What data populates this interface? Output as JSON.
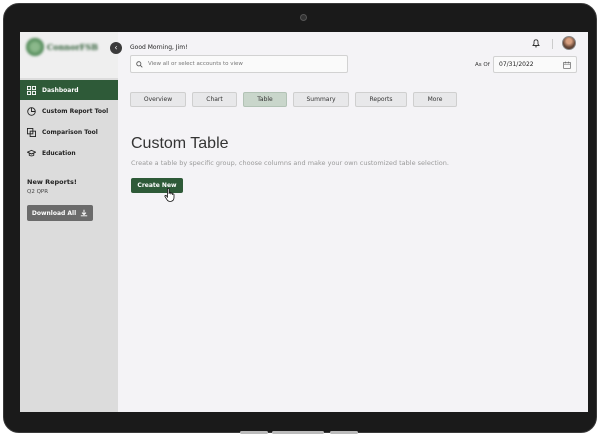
{
  "brand": {
    "logo_text": "ConnorFSB"
  },
  "sidebar": {
    "items": [
      {
        "label": "Dashboard",
        "icon": "dashboard-icon",
        "active": true
      },
      {
        "label": "Custom Report Tool",
        "icon": "pie-chart-icon",
        "active": false
      },
      {
        "label": "Comparison Tool",
        "icon": "compare-icon",
        "active": false
      },
      {
        "label": "Education",
        "icon": "graduation-cap-icon",
        "active": false
      }
    ],
    "new_reports_title": "New Reports!",
    "new_reports_sub": "Q2 QPR",
    "download_label": "Download All"
  },
  "header": {
    "greeting": "Good Morning, Jim!",
    "search_placeholder": "View all or select accounts to view",
    "as_of_label": "As Of",
    "date_value": "07/31/2022"
  },
  "tabs": [
    {
      "label": "Overview",
      "active": false
    },
    {
      "label": "Chart",
      "active": false
    },
    {
      "label": "Table",
      "active": true
    },
    {
      "label": "Summary",
      "active": false
    },
    {
      "label": "Reports",
      "active": false
    },
    {
      "label": "More",
      "active": false
    }
  ],
  "main": {
    "title": "Custom Table",
    "subtitle": "Create a table by specific group, choose columns and make your own customized table selection.",
    "create_label": "Create New"
  },
  "colors": {
    "accent": "#2e5a38",
    "sidebar_bg": "#dcdcdc",
    "content_bg": "#f4f3f6"
  }
}
